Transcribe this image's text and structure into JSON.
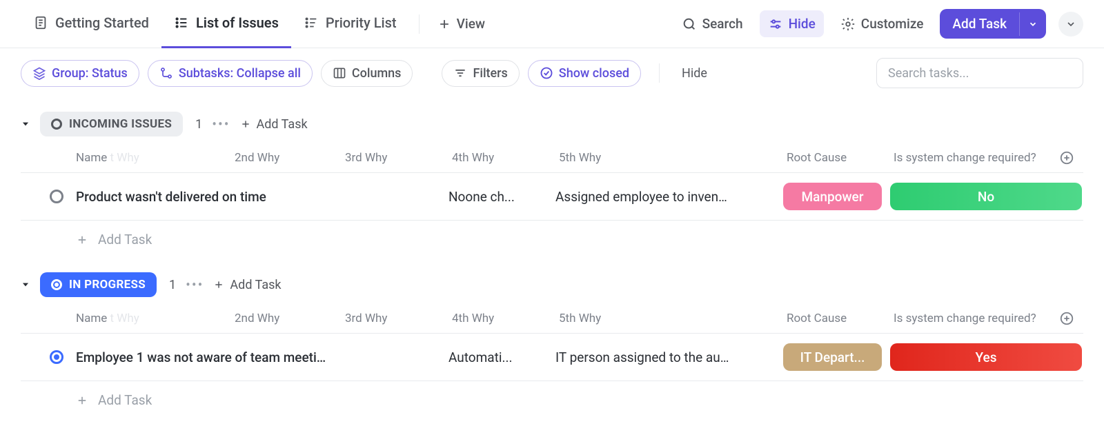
{
  "tabs": [
    {
      "label": "Getting Started",
      "active": false
    },
    {
      "label": "List of Issues",
      "active": true
    },
    {
      "label": "Priority List",
      "active": false
    }
  ],
  "view_button": "View",
  "toolbar": {
    "search": "Search",
    "hide": "Hide",
    "customize": "Customize",
    "add_task": "Add Task"
  },
  "filters": {
    "group": "Group: Status",
    "subtasks": "Subtasks: Collapse all",
    "columns": "Columns",
    "filters": "Filters",
    "show_closed": "Show closed",
    "hide": "Hide",
    "search_placeholder": "Search tasks..."
  },
  "columns": {
    "name": "Name",
    "first_why_ghost": "t Why",
    "second_why": "2nd Why",
    "third_why": "3rd Why",
    "fourth_why": "4th Why",
    "fifth_why": "5th Why",
    "root_cause": "Root Cause",
    "system_change": "Is system change required?"
  },
  "groups": [
    {
      "status_label": "INCOMING ISSUES",
      "count": "1",
      "add_label": "Add Task",
      "status_style": "gray",
      "tasks": [
        {
          "name": "Product wasn't delivered on time",
          "fourth_why": "Noone ch...",
          "fifth_why": "Assigned employee to inven…",
          "root_cause": "Manpower",
          "root_cause_style": "manpower",
          "system_change": "No",
          "system_change_style": "no",
          "status_circle": "gray"
        }
      ],
      "add_row": "Add Task"
    },
    {
      "status_label": "IN PROGRESS",
      "count": "1",
      "add_label": "Add Task",
      "status_style": "blue",
      "tasks": [
        {
          "name": "Employee 1 was not aware of team meeti…",
          "fourth_why": "Automati...",
          "fifth_why": "IT person assigned to the au…",
          "root_cause": "IT Depart...",
          "root_cause_style": "itdept",
          "system_change": "Yes",
          "system_change_style": "yes",
          "status_circle": "blue"
        }
      ],
      "add_row": "Add Task"
    }
  ]
}
